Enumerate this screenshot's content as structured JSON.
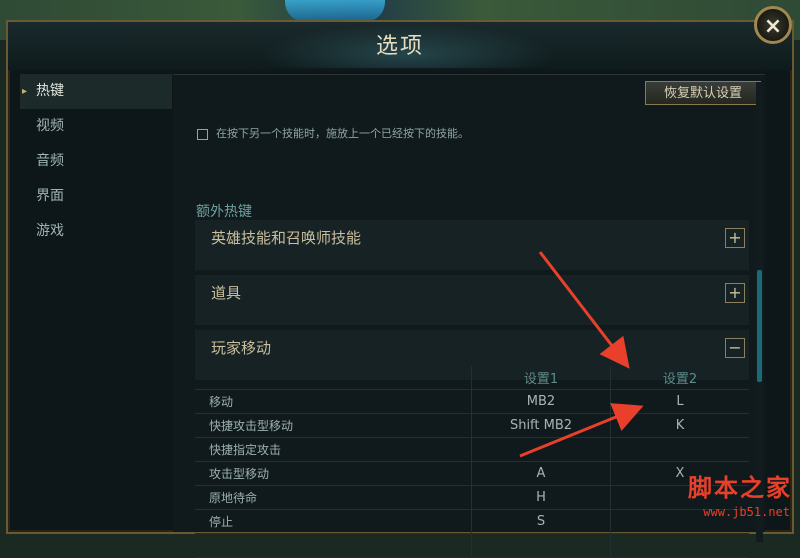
{
  "window": {
    "title": "选项",
    "close_label": "×"
  },
  "sidebar": {
    "items": [
      {
        "label": "热键",
        "active": true
      },
      {
        "label": "视频",
        "active": false
      },
      {
        "label": "音频",
        "active": false
      },
      {
        "label": "界面",
        "active": false
      },
      {
        "label": "游戏",
        "active": false
      }
    ]
  },
  "content": {
    "reset_button": "恢复默认设置",
    "checkbox_label": "在按下另一个技能时，施放上一个已经按下的技能。",
    "section_title": "额外热键",
    "groups": [
      {
        "label": "英雄技能和召唤师技能",
        "toggle": "+"
      },
      {
        "label": "道具",
        "toggle": "+"
      },
      {
        "label": "玩家移动",
        "toggle": "−"
      }
    ],
    "table": {
      "headers": [
        "",
        "设置1",
        "设置2"
      ],
      "rows": [
        {
          "name": "移动",
          "k1": "MB2",
          "k2": "L"
        },
        {
          "name": "快捷攻击型移动",
          "k1": "Shift  MB2",
          "k2": "K"
        },
        {
          "name": "快捷指定攻击",
          "k1": "",
          "k2": ""
        },
        {
          "name": "攻击型移动",
          "k1": "A",
          "k2": "X"
        },
        {
          "name": "原地待命",
          "k1": "H",
          "k2": ""
        },
        {
          "name": "停止",
          "k1": "S",
          "k2": ""
        },
        {
          "name": "",
          "k1": "",
          "k2": ""
        }
      ]
    }
  },
  "watermark": {
    "text": "脚本之家",
    "url": "www.jb51.net"
  },
  "colors": {
    "accent_gold": "#c8b070",
    "arrow_red": "#e8402a",
    "teal": "#6fa0a0"
  }
}
